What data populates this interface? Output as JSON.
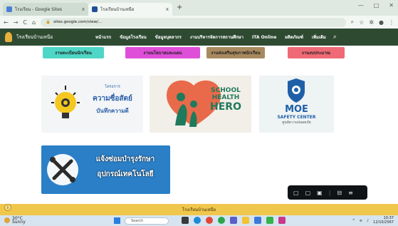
{
  "browser": {
    "tabs": [
      {
        "title": "โรงเรียน - Google Sites",
        "icon_color": "#4a7fd8"
      },
      {
        "title": "โรงเรียนบ้านเหนือ",
        "icon_color": "#1f4f9c"
      }
    ],
    "close_glyph": "x",
    "new_tab_glyph": "+",
    "url": "sites.google.com/view/...",
    "nav_glyphs": [
      "←",
      "→",
      "C",
      "⌂"
    ]
  },
  "site": {
    "name": "โรงเรียนบ้านเหนือ",
    "nav": [
      "หน้าแรก",
      "ข้อมูลโรงเรียน",
      "ข้อมูลบุคลากร",
      "งานบริหารจัดการสถานศึกษา",
      "ITA Online",
      "ผลิตภัณฑ์",
      "เพิ่มเติม"
    ],
    "search_icon": "search-icon"
  },
  "categories": [
    {
      "label": "งานทะเบียนนักเรียน",
      "color": "#4ed6c7"
    },
    {
      "label": "งานนโยบายและแผน",
      "color": "#df4ed8"
    },
    {
      "label": "งานส่งเสริมสุขภาพนักเรียน",
      "color": "#a98a5f"
    },
    {
      "label": "งานงบประมาณ",
      "color": "#ef6a76"
    }
  ],
  "cards": {
    "c1": {
      "line1": "โครงการ",
      "line2": "ความซื่อสัตย์",
      "line3": "บันทึกความดี"
    },
    "c2": {
      "line1": "SCHOOL",
      "line2": "HEALTH",
      "line3": "HERO"
    },
    "c3": {
      "line1": "MOE",
      "line2": "SAFETY CENTER",
      "line3": "ศูนย์ความปลอดภัย"
    },
    "c4": {
      "line1": "แจ้งซ่อมบำรุงรักษา",
      "line2": "อุปกรณ์เทคโนโลยี"
    }
  },
  "footer": {
    "text": "โรงเรียนบ้านเหนือ"
  },
  "taskbar": {
    "weather_temp": "30°C",
    "weather_desc": "Sunny",
    "search_placeholder": "Search",
    "time": "10:37",
    "date": "12/10/2567"
  }
}
